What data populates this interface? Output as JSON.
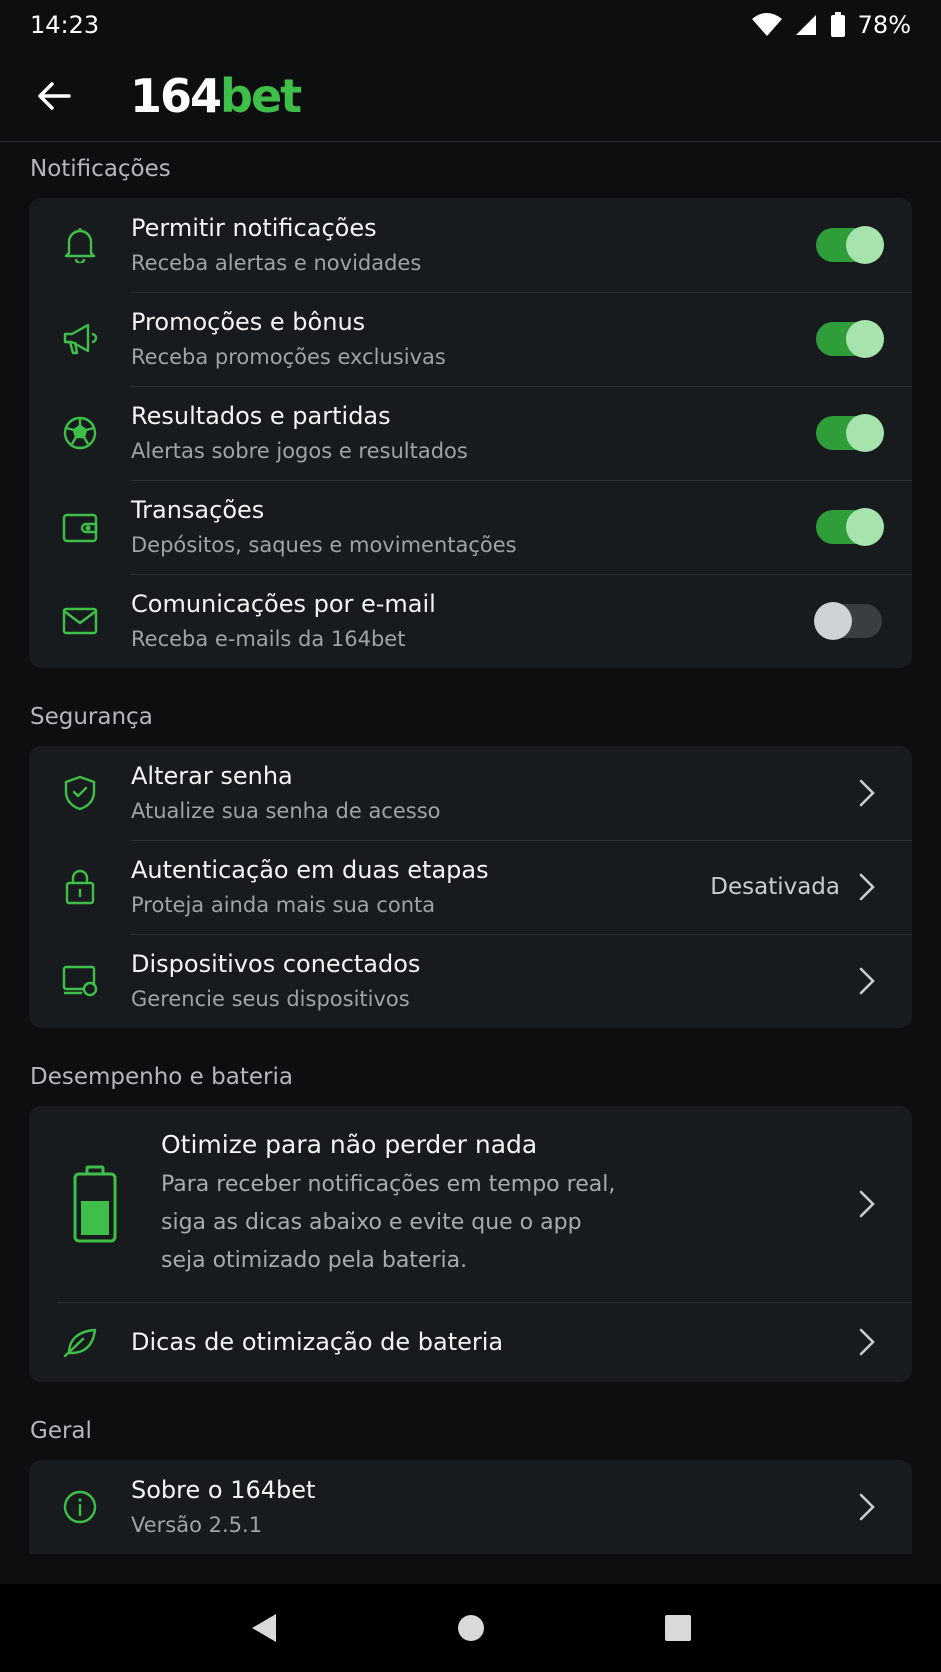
{
  "status": {
    "time": "14:23",
    "battery": "78%"
  },
  "header": {
    "logo_number": "164",
    "logo_word": "bet"
  },
  "sections": {
    "notifications": {
      "title": "Notificações",
      "items": [
        {
          "title": "Permitir notificações",
          "subtitle": "Receba alertas e novidades",
          "enabled": true,
          "icon": "bell-icon"
        },
        {
          "title": "Promoções e bônus",
          "subtitle": "Receba promoções exclusivas",
          "enabled": true,
          "icon": "megaphone-icon"
        },
        {
          "title": "Resultados e partidas",
          "subtitle": "Alertas sobre jogos e resultados",
          "enabled": true,
          "icon": "soccer-ball-icon"
        },
        {
          "title": "Transações",
          "subtitle": "Depósitos, saques e movimentações",
          "enabled": true,
          "icon": "wallet-icon"
        },
        {
          "title": "Comunicações por e-mail",
          "subtitle": "Receba e-mails da 164bet",
          "enabled": false,
          "icon": "mail-icon"
        }
      ]
    },
    "security": {
      "title": "Segurança",
      "items": [
        {
          "title": "Alterar senha",
          "subtitle": "Atualize sua senha de acesso",
          "icon": "shield-check-icon"
        },
        {
          "title": "Autenticação em duas etapas",
          "subtitle": "Proteja ainda mais sua conta",
          "value": "Desativada",
          "icon": "lock-icon"
        },
        {
          "title": "Dispositivos conectados",
          "subtitle": "Gerencie seus dispositivos",
          "icon": "devices-icon"
        }
      ]
    },
    "battery": {
      "title": "Desempenho e bateria",
      "promo_title": "Otimize para não perder nada",
      "promo_lines": [
        "Para receber notificações em tempo real,",
        "siga as dicas abaixo e evite que o app",
        "seja otimizado pela bateria."
      ],
      "tips_label": "Dicas de otimização de bateria"
    },
    "general": {
      "title": "Geral",
      "items": [
        {
          "title": "Sobre o 164bet",
          "subtitle": "Versão 2.5.1",
          "icon": "info-icon"
        }
      ]
    }
  },
  "colors": {
    "accent": "#3fbf4a",
    "background": "#0c0e10",
    "card": "#181b1e"
  }
}
